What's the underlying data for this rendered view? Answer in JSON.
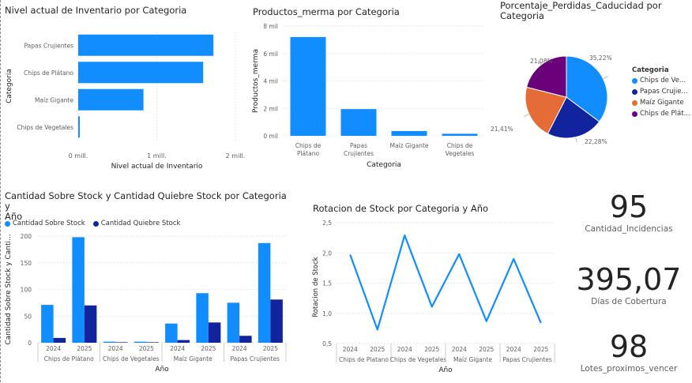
{
  "visuals": {
    "inventory": {
      "title": "Nivel actual de Inventario por Categoria",
      "chart_data": {
        "type": "bar",
        "orientation": "horizontal",
        "title": "Nivel actual de Inventario por Categoria",
        "xlabel": "Nivel actual de Inventario",
        "ylabel": "Categoria",
        "categories": [
          "Papas Crujientes",
          "Chips de Plátano",
          "Maíz Gigante",
          "Chips de Vegetales"
        ],
        "values": [
          1720000,
          1590000,
          830000,
          20000
        ],
        "xlim": [
          0,
          2000000
        ],
        "ticks": [
          0,
          1000000,
          2000000
        ],
        "tick_labels": [
          "0 mill.",
          "1 mill.",
          "2 mill."
        ],
        "grid": true
      }
    },
    "merma": {
      "title": "Productos_merma por Categoria",
      "chart_data": {
        "type": "bar",
        "title": "Productos_merma por Categoria",
        "xlabel": "Categoria",
        "ylabel": "Productos_merma",
        "categories": [
          "Chips de Plátano",
          "Papas Crujientes",
          "Maíz Gigante",
          "Chips de Vegetales"
        ],
        "category_lines": [
          [
            "Chips de",
            "Plátano"
          ],
          [
            "Papas",
            "Crujientes"
          ],
          [
            "Maíz Gigante"
          ],
          [
            "Chips de",
            "Vegetales"
          ]
        ],
        "values": [
          7200000,
          1950000,
          350000,
          150000
        ],
        "ylim": [
          0,
          8000000
        ],
        "ticks": [
          0,
          2000000,
          4000000,
          6000000,
          8000000
        ],
        "tick_labels": [
          "0 mil",
          "2 mil",
          "4 mil",
          "6 mil",
          "8 mil"
        ],
        "grid": true
      }
    },
    "perdidas": {
      "title": "Porcentaje_Perdidas_Caducidad por\nCategoria",
      "legend_title": "Categoria",
      "chart_data": {
        "type": "pie",
        "title": "Porcentaje_Perdidas_Caducidad por Categoria",
        "categories": [
          "Chips de Vegetales",
          "Papas Crujientes",
          "Maíz Gigante",
          "Chips de Plátano"
        ],
        "legend_labels": [
          "Chips de Ve...",
          "Papas Crujie...",
          "Maíz Gigante",
          "Chips de Plát..."
        ],
        "values": [
          35.22,
          22.28,
          21.41,
          21.08
        ],
        "data_labels": [
          "35,22%",
          "22,28%",
          "21,41%",
          "21,08%"
        ],
        "colors": [
          "#118DFF",
          "#12239E",
          "#E66C37",
          "#6B007B"
        ],
        "legend": "right"
      }
    },
    "stock": {
      "title": "Cantidad Sobre Stock y Cantidad Quiebre Stock por Categoria y\nAño",
      "chart_data": {
        "type": "bar",
        "title": "Cantidad Sobre Stock y Cantidad Quiebre Stock por Categoria y Año",
        "xlabel": "Año",
        "ylabel": "Cantidad Sobre Stock y Canti...",
        "groups": [
          "Chips de Plátano",
          "Chips de Vegetales",
          "Maíz Gigante",
          "Papas Crujientes"
        ],
        "years": [
          "2024",
          "2025"
        ],
        "series": [
          {
            "name": "Cantidad Sobre Stock",
            "color": "#118DFF",
            "values": [
              71,
              198,
              2,
              2,
              36,
              93,
              75,
              187
            ]
          },
          {
            "name": "Cantidad Quiebre Stock",
            "color": "#12239E",
            "values": [
              9,
              70,
              1,
              1,
              5,
              38,
              13,
              81
            ]
          }
        ],
        "ylim": [
          0,
          200
        ],
        "ticks": [
          0,
          50,
          100,
          150,
          200
        ],
        "legend": "top-left",
        "grid": true
      }
    },
    "rotacion": {
      "title": "Rotacion de Stock por Categoria y Año",
      "chart_data": {
        "type": "line",
        "title": "Rotacion de Stock por Categoria y Año",
        "xlabel": "Año",
        "ylabel": "Rotacion de Stock",
        "groups": [
          "Chips de Platano",
          "Chips de Vegetales",
          "Maíz Gigante",
          "Papas Crujientes"
        ],
        "years": [
          "2024",
          "2025"
        ],
        "series": [
          {
            "color": "#118DFF",
            "values": [
              1.97,
              0.73,
              2.29,
              1.11,
              1.98,
              0.87,
              1.9,
              0.84
            ]
          }
        ],
        "ylim": [
          0.5,
          2.5
        ],
        "ticks": [
          0.5,
          1.0,
          1.5,
          2.0,
          2.5
        ],
        "tick_labels": [
          "0,5",
          "1,0",
          "1,5",
          "2,0",
          "2,5"
        ],
        "grid": true
      }
    }
  },
  "cards": {
    "incidencias": {
      "value": "95",
      "label": "Cantidad_Incidencias"
    },
    "cobertura": {
      "value": "395,07",
      "label": "Días de Cobertura"
    },
    "lotes": {
      "value": "98",
      "label": "Lotes_proximos_vencer"
    }
  }
}
